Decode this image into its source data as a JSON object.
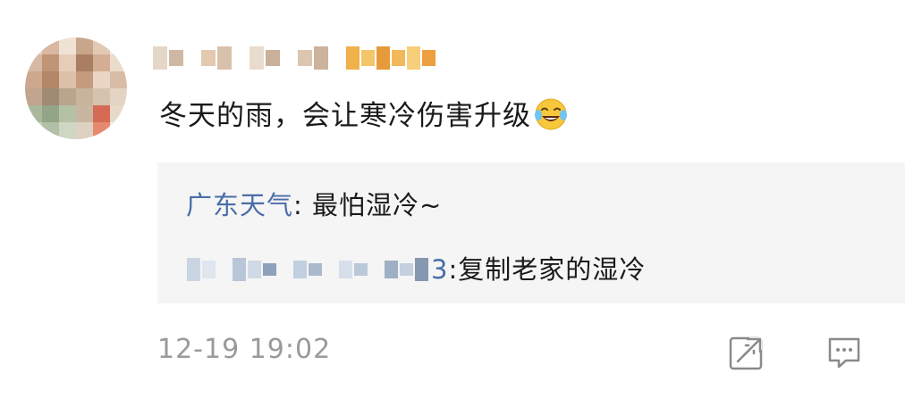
{
  "comment": {
    "author_name": "",
    "text": "冬天的雨，会让寒冷伤害升级",
    "emoji_icon": "laughing-tears-emoji-icon",
    "timestamp": "12-19 19:02"
  },
  "replies": [
    {
      "author": "广东天气",
      "separator": ": ",
      "text": "最怕湿冷~"
    },
    {
      "author_partial": "3",
      "separator": ": ",
      "text": "复制老家的湿冷"
    }
  ],
  "actions": {
    "share_icon": "share-icon",
    "comment_icon": "comment-icon"
  },
  "colors": {
    "link": "#4a6ea8",
    "text": "#1a1a1a",
    "muted": "#9a9a9a",
    "reply_bg": "#f5f5f5"
  }
}
